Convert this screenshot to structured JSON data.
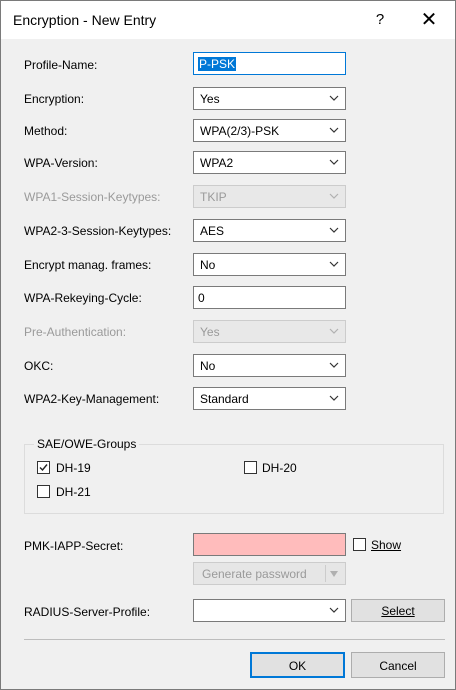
{
  "window": {
    "title": "Encryption - New Entry",
    "help_glyph": "?",
    "close_glyph": "✕"
  },
  "fields": {
    "profile_name": {
      "label": "Profile-Name:",
      "value": "P-PSK"
    },
    "encryption": {
      "label": "Encryption:",
      "value": "Yes"
    },
    "method": {
      "label": "Method:",
      "value": "WPA(2/3)-PSK"
    },
    "wpa_version": {
      "label": "WPA-Version:",
      "value": "WPA2"
    },
    "wpa1_session_keytypes": {
      "label": "WPA1-Session-Keytypes:",
      "value": "TKIP",
      "disabled": true
    },
    "wpa2_3_session_keytypes": {
      "label": "WPA2-3-Session-Keytypes:",
      "value": "AES"
    },
    "encrypt_manag_frames": {
      "label": "Encrypt manag. frames:",
      "value": "No"
    },
    "wpa_rekeying_cycle": {
      "label": "WPA-Rekeying-Cycle:",
      "value": "0"
    },
    "pre_authentication": {
      "label": "Pre-Authentication:",
      "value": "Yes",
      "disabled": true
    },
    "okc": {
      "label": "OKC:",
      "value": "No"
    },
    "wpa2_key_management": {
      "label": "WPA2-Key-Management:",
      "value": "Standard"
    }
  },
  "sae_owe_groups": {
    "title": "SAE/OWE-Groups",
    "dh19": {
      "label": "DH-19",
      "checked": true
    },
    "dh20": {
      "label": "DH-20",
      "checked": false
    },
    "dh21": {
      "label": "DH-21",
      "checked": false
    }
  },
  "pmk_iapp": {
    "label": "PMK-IAPP-Secret:",
    "value": "",
    "show_label": "Show",
    "show_checked": false,
    "generate_label": "Generate password"
  },
  "radius": {
    "label": "RADIUS-Server-Profile:",
    "value": "",
    "select_label": "Select"
  },
  "buttons": {
    "ok": "OK",
    "cancel": "Cancel"
  },
  "colors": {
    "accent": "#0078d7",
    "error_field": "#ffbcbc",
    "dialog_bg": "#f0f0f0"
  }
}
